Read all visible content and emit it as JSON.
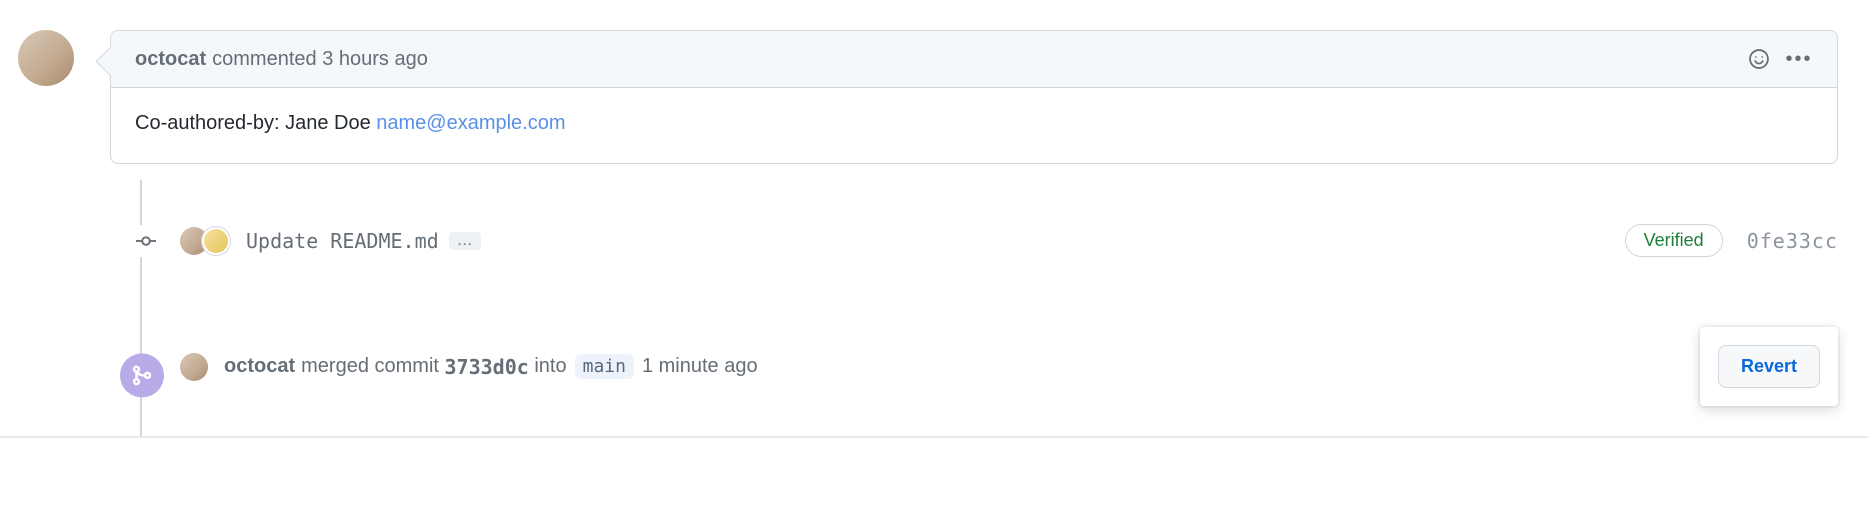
{
  "comment": {
    "author": "octocat",
    "action_text": "commented",
    "timestamp": "3 hours ago",
    "body_prefix": "Co-authored-by: Jane Doe ",
    "body_email": "name@example.com"
  },
  "commit_event": {
    "message": "Update README.md",
    "verified_label": "Verified",
    "short_hash": "0fe33cc"
  },
  "merge_event": {
    "author": "octocat",
    "action_text": "merged commit",
    "commit_short": "3733d0c",
    "into_text": "into",
    "branch": "main",
    "timestamp": "1 minute ago",
    "revert_label": "Revert"
  },
  "icons": {
    "smiley": "smiley-icon",
    "kebab": "kebab-icon",
    "commit": "git-commit-icon",
    "merge": "git-merge-icon",
    "ellipsis": "ellipsis-icon"
  }
}
